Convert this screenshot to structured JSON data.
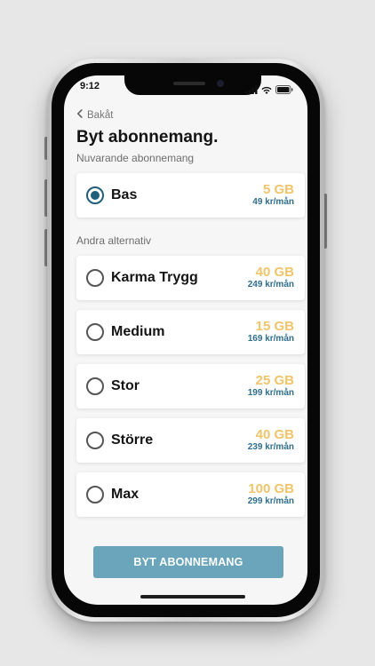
{
  "status": {
    "time": "9:12"
  },
  "nav": {
    "back_label": "Bakåt"
  },
  "title": "Byt abonnemang.",
  "current": {
    "label": "Nuvarande abonnemang",
    "plan": {
      "name": "Bas",
      "data": "5 GB",
      "price": "49 kr/mån",
      "selected": true
    }
  },
  "alternatives": {
    "label": "Andra alternativ",
    "plans": [
      {
        "name": "Karma Trygg",
        "data": "40 GB",
        "price": "249 kr/mån",
        "selected": false
      },
      {
        "name": "Medium",
        "data": "15 GB",
        "price": "169 kr/mån",
        "selected": false
      },
      {
        "name": "Stor",
        "data": "25 GB",
        "price": "199 kr/mån",
        "selected": false
      },
      {
        "name": "Större",
        "data": "40 GB",
        "price": "239 kr/mån",
        "selected": false
      },
      {
        "name": "Max",
        "data": "100 GB",
        "price": "299 kr/mån",
        "selected": false
      }
    ]
  },
  "cta": {
    "label": "BYT ABONNEMANG"
  },
  "colors": {
    "accent": "#1f5f7a",
    "data_amount": "#f0c46a",
    "price": "#2f6f8e",
    "button": "#6aa5bb"
  },
  "icons": [
    "chevron-left-icon",
    "signal-icon",
    "wifi-icon",
    "battery-icon"
  ]
}
